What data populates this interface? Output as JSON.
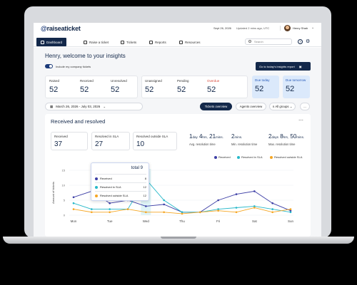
{
  "app": {
    "logo_prefix": "@",
    "logo_text": "raiseaticket"
  },
  "header": {
    "date": "Sept 26, 2026",
    "updated": "Updated 2 mins ago, UTC",
    "user_name": "Henry Shah"
  },
  "nav": {
    "items": [
      {
        "label": "Dashboard",
        "icon": "grid-icon",
        "active": true
      },
      {
        "label": "Raise a ticket",
        "icon": "ticket-icon"
      },
      {
        "label": "Tickets",
        "icon": "mail-icon"
      },
      {
        "label": "Reports",
        "icon": "report-icon"
      },
      {
        "label": "Resources",
        "icon": "folder-icon"
      }
    ],
    "search_placeholder": "Search"
  },
  "welcome": {
    "title": "Henry, welcome to your insights",
    "toggle_label": "Include my company tickets",
    "insights_button": "Go to today's insights report"
  },
  "stats": {
    "group1": [
      {
        "label": "Raised",
        "value": "52"
      },
      {
        "label": "Received",
        "value": "52"
      },
      {
        "label": "Unresolved",
        "value": "52"
      }
    ],
    "group2": [
      {
        "label": "Unassigned",
        "value": "52"
      },
      {
        "label": "Pending",
        "value": "52"
      },
      {
        "label": "Overdue",
        "value": "52"
      }
    ],
    "due": [
      {
        "label": "Due today",
        "value": "52"
      },
      {
        "label": "Due tomorrow",
        "value": "52"
      }
    ]
  },
  "filters": {
    "date_range": "March 26, 2026 - July 03, 2026",
    "tickets_overview": "Tickets overview",
    "agents_overview": "Agents overview",
    "groups": "All groups",
    "more": "..."
  },
  "panel": {
    "title": "Received and resolved",
    "cards": [
      {
        "label": "Received",
        "value": "37"
      },
      {
        "label": "Resolved in SLA",
        "value": "27"
      },
      {
        "label": "Resolved outside SLA",
        "value": "10"
      }
    ],
    "resolution": [
      {
        "a": "1",
        "a_unit": "day",
        "b": "4",
        "b_unit": "hrs,",
        "c": "21",
        "c_unit": "mins.",
        "label": "Avg. resolution time"
      },
      {
        "a": "2",
        "a_unit": "mins.",
        "b": "",
        "b_unit": "",
        "c": "",
        "c_unit": "",
        "label": "Min. resolution time"
      },
      {
        "a": "2",
        "a_unit": "days",
        "b": "8",
        "b_unit": "hrs,",
        "c": "50",
        "c_unit": "mins.",
        "label": "Max. resolution time"
      }
    ]
  },
  "tooltip": {
    "total_label": "total 9",
    "rows": [
      {
        "label": "Received",
        "value": "8",
        "color": "#3d3fa6"
      },
      {
        "label": "Resolved in SLA",
        "value": "12",
        "color": "#26b8c9"
      },
      {
        "label": "Resolved outside SLA",
        "value": "12",
        "color": "#f5a623"
      }
    ]
  },
  "chart_data": {
    "type": "line",
    "ylabel": "Amount of tickets",
    "ylim": [
      0,
      15
    ],
    "yticks": [
      "0",
      "5",
      "10",
      "15"
    ],
    "x": [
      "Mon",
      "",
      "Tue",
      "",
      "Wed",
      "",
      "Thu",
      "",
      "Fri",
      "",
      "Sat",
      "",
      "Sun"
    ],
    "series": [
      {
        "name": "Received",
        "color": "#3d3fa6",
        "values": [
          6,
          8,
          4,
          5,
          3,
          3.6,
          1,
          1,
          5,
          7,
          8,
          4,
          1.5
        ]
      },
      {
        "name": "Resolved in SLA",
        "color": "#26b8c9",
        "values": [
          4,
          2,
          2,
          2,
          12,
          5,
          1,
          1,
          2,
          2.5,
          3,
          2,
          1
        ]
      },
      {
        "name": "Resolved outside SLA",
        "color": "#f5a623",
        "values": [
          2,
          1,
          1,
          2,
          1,
          1,
          0.5,
          1,
          1.5,
          1,
          2.5,
          1,
          2
        ]
      }
    ],
    "highlight_index": 4
  }
}
